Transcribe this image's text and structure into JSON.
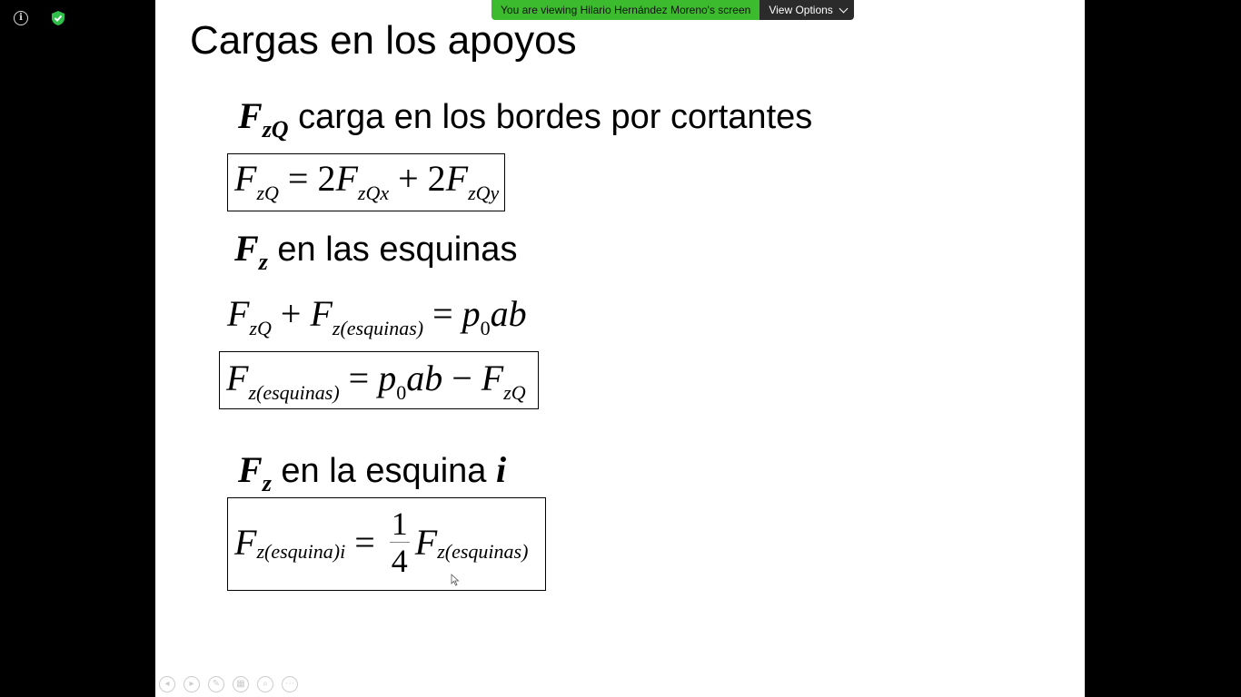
{
  "banner": {
    "message": "You are viewing Hilario Hernández Moreno's screen",
    "options_label": "View Options"
  },
  "slide": {
    "title": "Cargas en los apoyos",
    "section1": {
      "var": "F",
      "sub": "zQ",
      "text": " carga en los bordes por cortantes"
    },
    "eq1": {
      "lhs": "F",
      "lhs_sub": "zQ",
      "op": " = 2",
      "t1": "F",
      "t1_sub": "zQx",
      "plus": " + 2",
      "t2": "F",
      "t2_sub": "zQy"
    },
    "section2": {
      "var": "F",
      "sub": "z",
      "text": " en las esquinas"
    },
    "eq2": {
      "a": "F",
      "a_sub": "zQ",
      "plus": " + ",
      "b": "F",
      "b_sub": "z(esquinas)",
      "eq": " = ",
      "p": "p",
      "p_sub": "0",
      "ab": "ab"
    },
    "eq3": {
      "a": "F",
      "a_sub": "z(esquinas)",
      "eq": " = ",
      "p": "p",
      "p_sub": "0",
      "ab": "ab",
      "minus": " − ",
      "b": "F",
      "b_sub": "zQ"
    },
    "section3": {
      "var": "F",
      "sub": "z",
      "text": " en la esquina ",
      "idx": "i"
    },
    "eq4": {
      "a": "F",
      "a_sub": "z(esquina)i",
      "eq": " = ",
      "num": "1",
      "den": "4",
      "b": "F",
      "b_sub": "z(esquinas)"
    }
  }
}
